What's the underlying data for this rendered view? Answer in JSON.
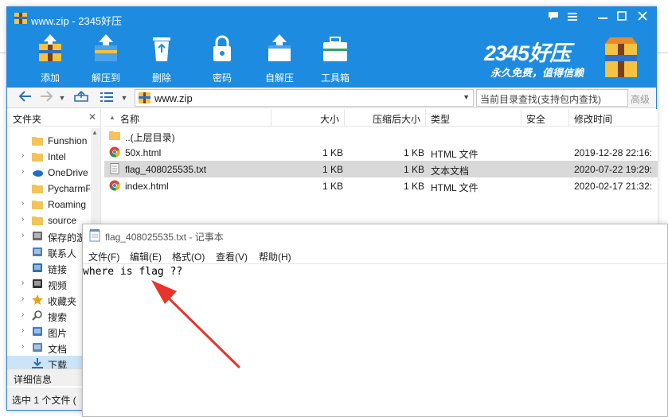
{
  "window": {
    "title": "www.zip - 2345好压"
  },
  "toolbar": {
    "buttons": [
      {
        "label": "添加",
        "icon": "add-archive-icon"
      },
      {
        "label": "解压到",
        "icon": "extract-icon"
      },
      {
        "label": "删除",
        "icon": "recycle-bin-icon"
      },
      {
        "label": "密码",
        "icon": "lock-icon"
      },
      {
        "label": "自解压",
        "icon": "self-extract-icon"
      },
      {
        "label": "工具箱",
        "icon": "toolbox-icon"
      }
    ],
    "brand_name": "2345好压",
    "brand_slogan": "永久免费，值得信赖"
  },
  "address": {
    "path": "www.zip",
    "search_placeholder": "当前目录查找(支持包内查找)",
    "advanced": "高级"
  },
  "left_pane": {
    "header": "文件夹",
    "items": [
      {
        "label": "Funshion",
        "icon": "folder-icon",
        "chev": false
      },
      {
        "label": "Intel",
        "icon": "folder-icon",
        "chev": true
      },
      {
        "label": "OneDrive",
        "icon": "onedrive-icon",
        "chev": true
      },
      {
        "label": "PycharmP",
        "icon": "folder-icon",
        "chev": false
      },
      {
        "label": "Roaming",
        "icon": "folder-icon",
        "chev": true
      },
      {
        "label": "source",
        "icon": "folder-icon",
        "chev": true
      },
      {
        "label": "保存的游",
        "icon": "saved-games-icon",
        "chev": true
      },
      {
        "label": "联系人",
        "icon": "contacts-icon",
        "chev": false
      },
      {
        "label": "链接",
        "icon": "link-icon",
        "chev": false
      },
      {
        "label": "视频",
        "icon": "video-icon",
        "chev": true
      },
      {
        "label": "收藏夹",
        "icon": "favorites-icon",
        "chev": true
      },
      {
        "label": "搜索",
        "icon": "search-icon",
        "chev": true
      },
      {
        "label": "图片",
        "icon": "pictures-icon",
        "chev": true
      },
      {
        "label": "文档",
        "icon": "documents-icon",
        "chev": true
      },
      {
        "label": "下载",
        "icon": "download-icon",
        "chev": false,
        "selected": true
      }
    ],
    "details": "详细信息",
    "status": "选中 1 个文件 ("
  },
  "file_list": {
    "columns": [
      "名称",
      "大小",
      "压缩后大小",
      "类型",
      "安全",
      "修改时间"
    ],
    "rows": [
      {
        "name": "..(上层目录)",
        "size": "",
        "packed": "",
        "type": "",
        "security": "",
        "modified": "",
        "icon": "folder-icon"
      },
      {
        "name": "50x.html",
        "size": "1 KB",
        "packed": "1 KB",
        "type": "HTML 文件",
        "security": "",
        "modified": "2019-12-28 22:16:",
        "icon": "chrome-icon"
      },
      {
        "name": "flag_408025535.txt",
        "size": "1 KB",
        "packed": "1 KB",
        "type": "文本文档",
        "security": "",
        "modified": "2020-07-22 19:29:",
        "icon": "text-file-icon",
        "selected": true
      },
      {
        "name": "index.html",
        "size": "1 KB",
        "packed": "1 KB",
        "type": "HTML 文件",
        "security": "",
        "modified": "2020-02-17 21:32:",
        "icon": "chrome-icon"
      }
    ]
  },
  "notepad": {
    "title": "flag_408025535.txt - 记事本",
    "menu": [
      "文件(F)",
      "编辑(E)",
      "格式(O)",
      "查看(V)",
      "帮助(H)"
    ],
    "content": "where is flag ??"
  },
  "colors": {
    "accent": "#1d8ce0",
    "annotation": "#e8342a"
  }
}
